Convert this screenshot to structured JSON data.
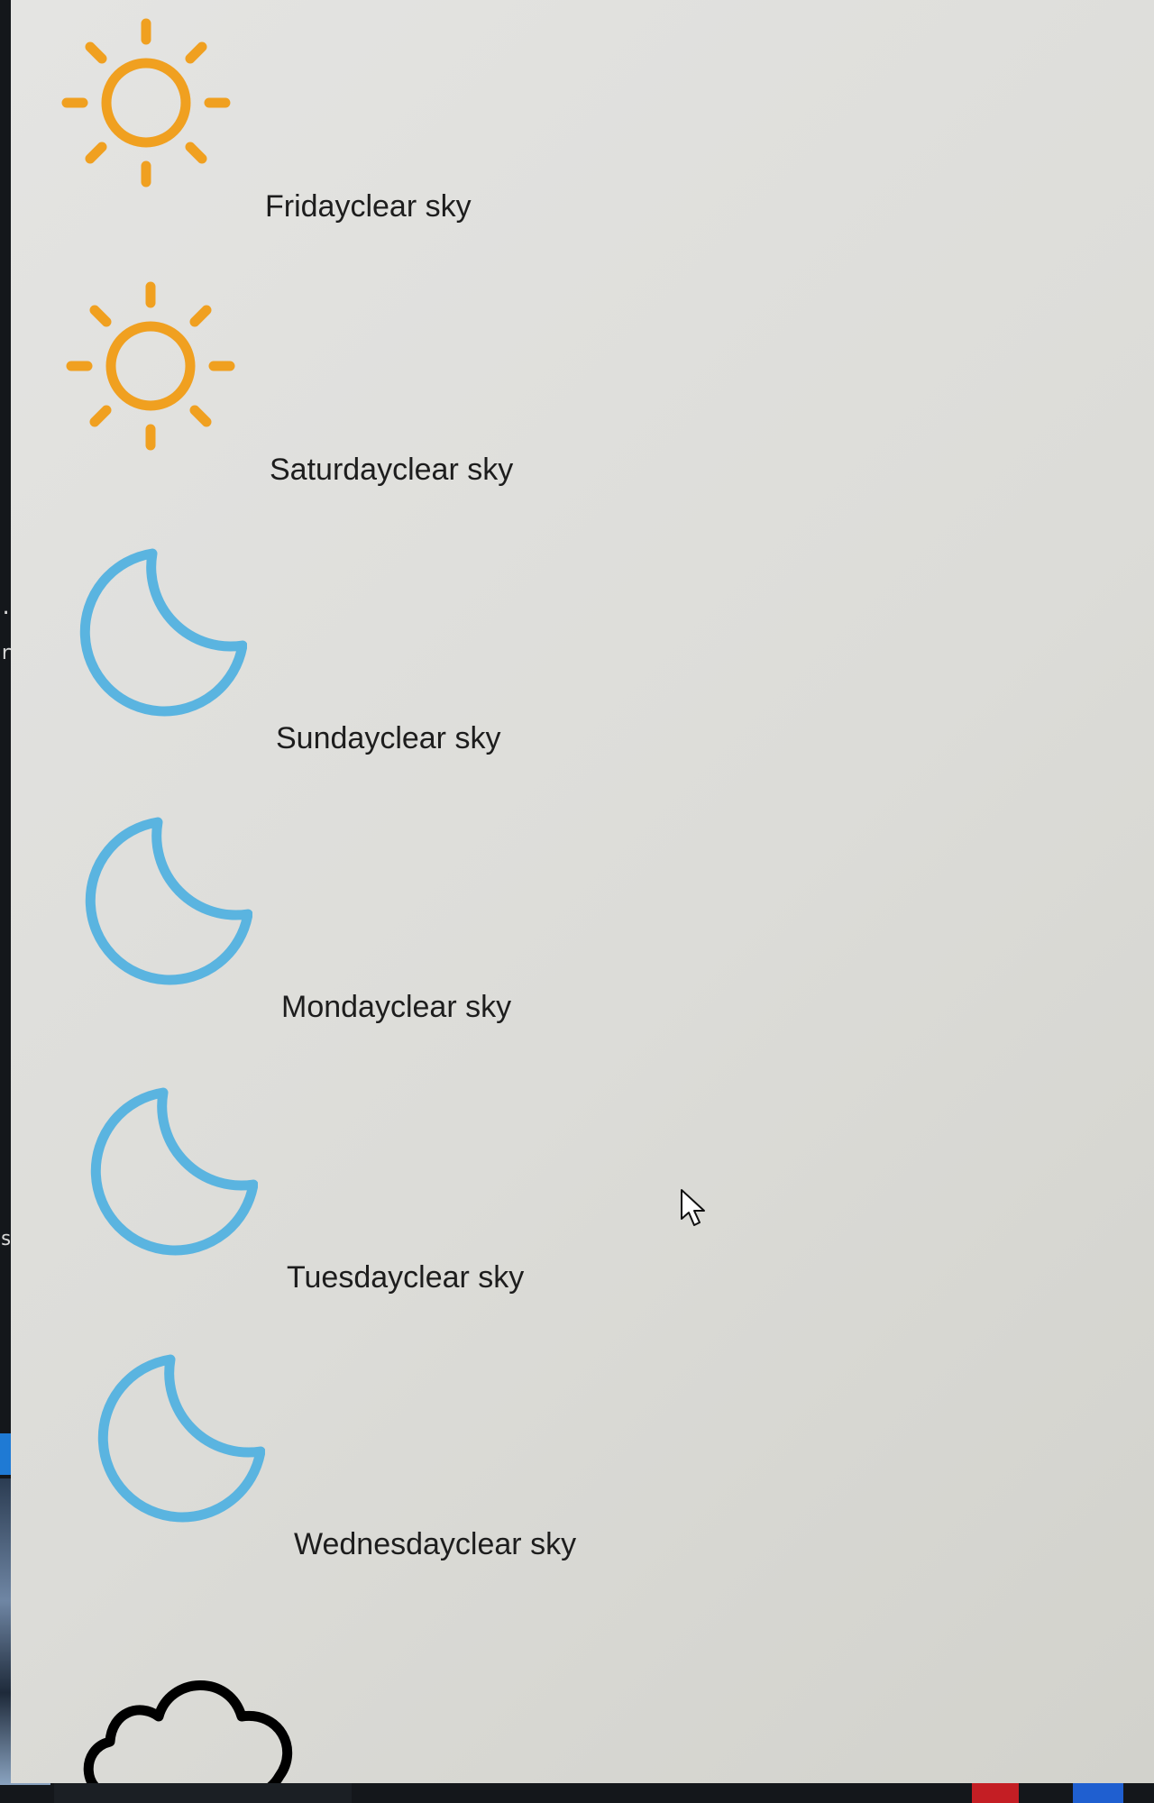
{
  "forecast": [
    {
      "day": "Friday",
      "description": "clear sky",
      "label": "Fridayclear sky",
      "icon": "sun-icon"
    },
    {
      "day": "Saturday",
      "description": "clear sky",
      "label": "Saturdayclear sky",
      "icon": "sun-icon"
    },
    {
      "day": "Sunday",
      "description": "clear sky",
      "label": "Sundayclear sky",
      "icon": "moon-icon"
    },
    {
      "day": "Monday",
      "description": "clear sky",
      "label": "Mondayclear sky",
      "icon": "moon-icon"
    },
    {
      "day": "Tuesday",
      "description": "clear sky",
      "label": "Tuesdayclear sky",
      "icon": "moon-icon"
    },
    {
      "day": "Wednesday",
      "description": "clear sky",
      "label": "Wednesdayclear sky",
      "icon": "moon-icon"
    },
    {
      "day": "",
      "description": "",
      "label": "",
      "icon": "cloud-icon"
    }
  ],
  "backdrop": {
    "fragment_1": ".c",
    "fragment_2": "r.j",
    "fragment_3": "s"
  },
  "colors": {
    "sun": "#f0a020",
    "moon": "#5ab4e0",
    "cloud": "#000000",
    "text": "#1d1d1d",
    "background": "#e0e0dd"
  }
}
